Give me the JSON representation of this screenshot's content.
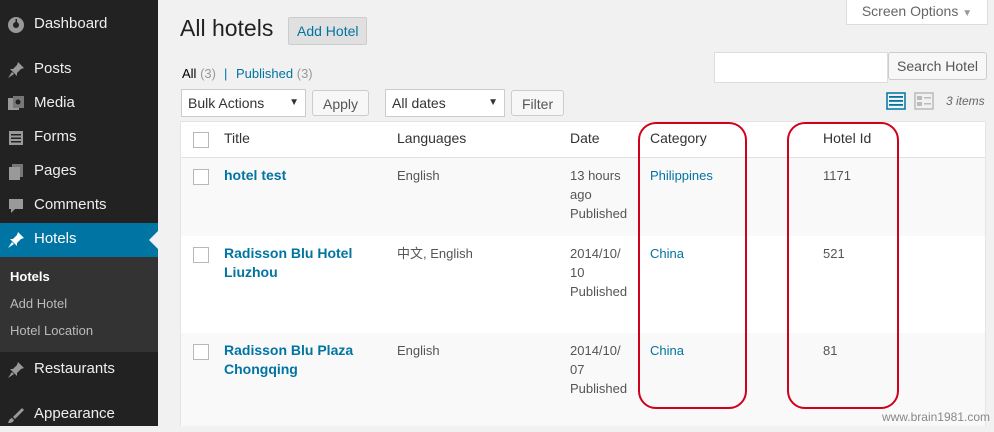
{
  "sidebar": {
    "items": [
      {
        "label": "Dashboard",
        "icon": "dashboard-icon"
      },
      {
        "label": "Posts",
        "icon": "pin-icon"
      },
      {
        "label": "Media",
        "icon": "media-icon"
      },
      {
        "label": "Forms",
        "icon": "forms-icon"
      },
      {
        "label": "Pages",
        "icon": "pages-icon"
      },
      {
        "label": "Comments",
        "icon": "comments-icon"
      },
      {
        "label": "Hotels",
        "icon": "pin-icon"
      },
      {
        "label": "Restaurants",
        "icon": "pin-icon"
      },
      {
        "label": "Appearance",
        "icon": "appearance-icon"
      }
    ],
    "submenu": [
      "Hotels",
      "Add Hotel",
      "Hotel Location"
    ],
    "active_color": "#0074a2"
  },
  "header": {
    "title": "All hotels",
    "add_button": "Add Hotel",
    "screen_options": "Screen Options"
  },
  "filters": {
    "all_label": "All",
    "all_count": "(3)",
    "separator": "|",
    "published_label": "Published",
    "published_count": "(3)"
  },
  "search": {
    "button": "Search Hotel",
    "value": ""
  },
  "bulk": {
    "selected": "Bulk Actions",
    "apply": "Apply"
  },
  "dates": {
    "selected": "All dates",
    "filter": "Filter"
  },
  "items_count": "3 items",
  "table": {
    "columns": [
      "Title",
      "Languages",
      "Date",
      "Category",
      "Hotel Id"
    ],
    "rows": [
      {
        "title": [
          "hotel test"
        ],
        "languages": "English",
        "date": [
          "13 hours",
          "ago",
          "Published"
        ],
        "category": "Philippines",
        "id": "1171"
      },
      {
        "title": [
          "Radisson Blu Hotel",
          "Liuzhou"
        ],
        "languages": "中文, English",
        "date": [
          "2014/10/",
          "10",
          "Published"
        ],
        "category": "China",
        "id": "521"
      },
      {
        "title": [
          "Radisson Blu Plaza",
          "Chongqing"
        ],
        "languages": "English",
        "date": [
          "2014/10/",
          "07",
          "Published"
        ],
        "category": "China",
        "id": "81"
      }
    ]
  },
  "watermark": "www.brain1981.com"
}
